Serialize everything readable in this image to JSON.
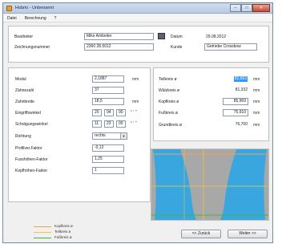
{
  "window": {
    "title": "Hobrio - Unbenannt",
    "min_label": "–",
    "max_label": "□",
    "close_label": "✕"
  },
  "menu": [
    "Datei",
    "Berechnung",
    "?"
  ],
  "header": {
    "bearbeiter_label": "Bearbeiter",
    "bearbeiter_value": "Mike Ambeiter",
    "zeichnungsnummer_label": "Zeichnungsnummer",
    "zeichnungsnummer_value": "2360 28.5012",
    "datum_label": "Datum",
    "datum_value": "29.08.2012",
    "kunde_label": "Kunde",
    "kunde_value": "Getriebe Crossbow"
  },
  "params": {
    "modul_label": "Modul",
    "modul_value": "2,1887",
    "modul_unit": "mm",
    "zaehnezahl_label": "Zähnezahl",
    "zaehnezahl_value": "37",
    "zahnbreite_label": "Zahnbreite",
    "zahnbreite_value": "18,5",
    "zahnbreite_unit": "mm",
    "eingriffswinkel_label": "Eingriffswinkel",
    "eingriffswinkel_deg": "20",
    "eingriffswinkel_min": "04",
    "eingriffswinkel_sec": "00",
    "schraegungswinkel_label": "Schrägungswinkel",
    "schraegungswinkel_deg": "11",
    "schraegungswinkel_min": "23",
    "schraegungswinkel_sec": "00",
    "angle_unit": "° ' ''",
    "richtung_label": "Richtung",
    "richtung_value": "rechts",
    "profilverschiebung_label": "Profilver.Faktor",
    "profilverschiebung_value": "-0,12",
    "fusshoehen_label": "Fusshöhen-Faktor",
    "fusshoehen_value": "1,25",
    "kopfhoehen_label": "Kopfhöhen-Faktor",
    "kopfhoehen_value": "1"
  },
  "results": {
    "teilkreis_label": "Teilkreis ø",
    "teilkreis_value": "82,562",
    "teilkreis_unit": "mm",
    "waelzkreis_label": "Wälzkreis ø",
    "waelzkreis_value": "81,332",
    "waelzkreis_unit": "mm",
    "kopfkreis_label": "Kopfkreis ø",
    "kopfkreis_value": "85,969",
    "kopfkreis_unit": "mm",
    "fusskreis_label": "Fußkreis ø",
    "fusskreis_value": "75,910",
    "fusskreis_unit": "mm",
    "grundkreis_label": "Grundkreis ø",
    "grundkreis_value": "76,700",
    "grundkreis_unit": "mm"
  },
  "legend": [
    {
      "label": "Kopfkreis ø",
      "color": "#f0a050"
    },
    {
      "label": "Teilkreis ø",
      "color": "#f0c830"
    },
    {
      "label": "Fußkreis ø",
      "color": "#40b840"
    }
  ],
  "buttons": {
    "back_label": "<< Zurück",
    "next_label": "Weiter >>"
  },
  "colors": {
    "accent": "#3399ff",
    "tooth_fill": "#3aa6e0",
    "gap_fill": "#a8a8a8"
  }
}
